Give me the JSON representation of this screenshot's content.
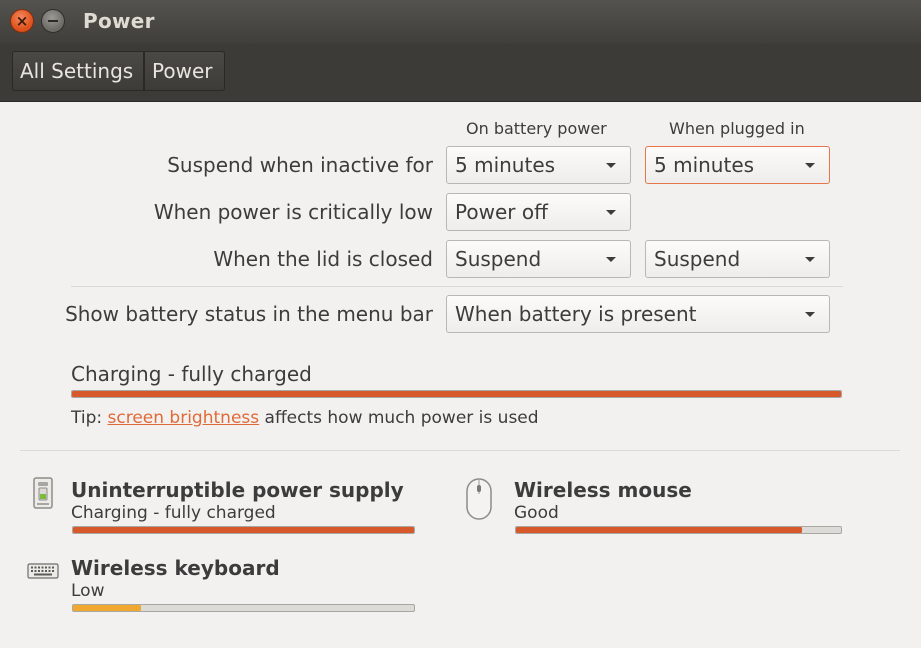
{
  "window": {
    "title": "Power"
  },
  "breadcrumb": {
    "all_settings": "All Settings",
    "power": "Power"
  },
  "headers": {
    "battery": "On battery power",
    "plugged": "When plugged in"
  },
  "settings": {
    "suspend": {
      "label": "Suspend when inactive for",
      "battery": "5 minutes",
      "plugged": "5 minutes"
    },
    "critical": {
      "label": "When power is critically low",
      "battery": "Power off"
    },
    "lid": {
      "label": "When the lid is closed",
      "battery": "Suspend",
      "plugged": "Suspend"
    },
    "status": {
      "label": "Show battery status in the menu bar",
      "value": "When battery is present"
    }
  },
  "battery": {
    "status": "Charging - fully charged",
    "level": 1.0
  },
  "tip": {
    "prefix": "Tip: ",
    "link": "screen brightness",
    "suffix": " affects how much power is used"
  },
  "devices": [
    {
      "name": "Uninterruptible power supply",
      "status": "Charging - fully charged",
      "level": 1.0,
      "icon": "ups-icon"
    },
    {
      "name": "Wireless mouse",
      "status": "Good",
      "level": 0.88,
      "icon": "mouse-icon"
    },
    {
      "name": "Wireless keyboard",
      "status": "Low",
      "level": 0.2,
      "icon": "keyboard-icon"
    }
  ],
  "colors": {
    "accent": "#e06a37",
    "bar_fill": "#d7582a",
    "low_fill": "#f0a830",
    "titlebar": "#3c3b37"
  }
}
